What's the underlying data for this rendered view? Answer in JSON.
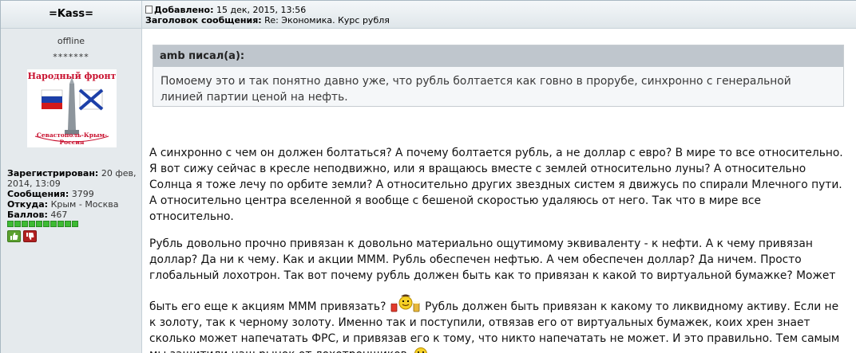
{
  "author": {
    "name": "=Kass=",
    "status": "offline",
    "rank": "*******",
    "avatar_top_text": "Народный фронт",
    "avatar_bottom_text": "Севастополь-Крым-Россия",
    "registered_label": "Зарегистрирован:",
    "registered_value": " 20 фев, 2014, 13:09",
    "posts_label": "Сообщения:",
    "posts_value": " 3799",
    "from_label": "Откуда:",
    "from_value": " Крым - Москва",
    "points_label": "Баллов:",
    "points_value": " 467",
    "reputation_pips": 10
  },
  "post": {
    "added_label": "Добавлено:",
    "added_value": " 15 дек, 2015, 13:56",
    "subject_label": "Заголовок сообщения:",
    "subject_value": " Re: Экономика. Курс рубля"
  },
  "quote": {
    "author_line": "amb писал(а):",
    "text": "Помоему это и так понятно давно уже, что рубль болтается как говно в прорубе, синхронно с генеральной линией партии ценой на нефть."
  },
  "body": {
    "para1": "А синхронно с чем он должен болтаться? А почему болтается рубль, а не доллар с евро? В мире то все относительно. Я вот сижу сейчас в кресле неподвижно, или я вращаюсь вместе с землей относительно луны? А относительно Солнца я тоже лечу по орбите земли? А относительно других звездных систем я движусь по спирали Млечного пути. А относительно центра вселенной я вообще с бешеной скоростью удаляюсь от него. Так что в мире все относительно.",
    "para2a": "Рубль довольно прочно привязан к довольно материально ощутимому эквиваленту - к нефти. А к чему привязан доллар? Да ни к чему. Как и акции МММ. Рубль обеспечен нефтью. А чем обеспечен доллар? Да ничем. Просто глобальный лохотрон. Так вот почему рубль должен быть как то привязан к какой то виртуальной бумажке? Может",
    "para2b": "быть его еще к акциям МММ привязать? ",
    "para2c": " Рубль должен быть привязан к какому то ликвидному активу. Если не к золоту, так к черному золоту. Именно так и поступили, отвязав его от виртуальных бумажек, коих хрен знает сколько может напечатать ФРС, и привязав его к тому, что никто напечатать не может. И это правильно. Тем самым мы защитили наш рынок от лохотронщиков. "
  },
  "colors": {
    "sidebar_bg": "#e5eaed",
    "quote_header_bg": "#bfc6cd",
    "reputation_green": "#3dbb33"
  },
  "icons": [
    "post-doc-icon",
    "thumbs-up-icon",
    "thumbs-down-icon",
    "beer-smiley-icon",
    "smiley-icon"
  ]
}
